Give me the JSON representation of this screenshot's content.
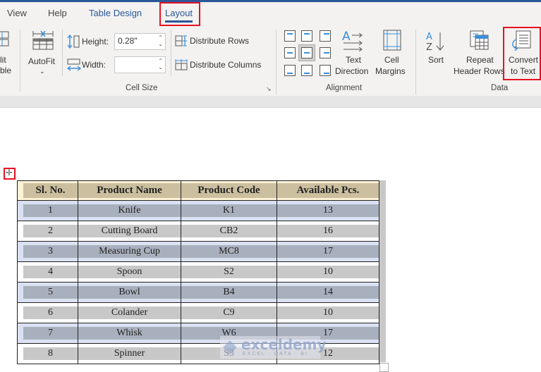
{
  "tabs": [
    {
      "label": "View",
      "active": false
    },
    {
      "label": "Help",
      "active": false
    },
    {
      "label": "Table Design",
      "active": false
    },
    {
      "label": "Layout",
      "active": true
    }
  ],
  "ribbon": {
    "split_table": {
      "line1": "lit",
      "line2": "ble"
    },
    "autofit": {
      "label": "AutoFit"
    },
    "height": {
      "label": "Height:",
      "value": "0.28\""
    },
    "width": {
      "label": "Width:",
      "value": ""
    },
    "distribute_rows": "Distribute Rows",
    "distribute_columns": "Distribute Columns",
    "cell_size_group": "Cell Size",
    "text_direction": {
      "line1": "Text",
      "line2": "Direction"
    },
    "cell_margins": {
      "line1": "Cell",
      "line2": "Margins"
    },
    "alignment_group": "Alignment",
    "sort": "Sort",
    "repeat_header": {
      "line1": "Repeat",
      "line2": "Header Rows"
    },
    "convert_to_text": {
      "line1": "Convert",
      "line2": "to Text"
    },
    "data_group": "Data"
  },
  "table": {
    "headers": [
      "Sl. No.",
      "Product Name",
      "Product Code",
      "Available Pcs."
    ],
    "rows": [
      [
        "1",
        "Knife",
        "K1",
        "13"
      ],
      [
        "2",
        "Cutting Board",
        "CB2",
        "16"
      ],
      [
        "3",
        "Measuring Cup",
        "MC8",
        "17"
      ],
      [
        "4",
        "Spoon",
        "S2",
        "10"
      ],
      [
        "5",
        "Bowl",
        "B4",
        "14"
      ],
      [
        "6",
        "Colander",
        "C9",
        "10"
      ],
      [
        "7",
        "Whisk",
        "W6",
        "17"
      ],
      [
        "8",
        "Spinner",
        "S3",
        "12"
      ]
    ]
  },
  "watermark": {
    "brand": "exceldemy",
    "tagline": "EXCEL · DATA · BI"
  },
  "colors": {
    "accent": "#2b579a",
    "highlight_box": "#e81123",
    "header_fill": "#cbbf9f",
    "band_blue": "#d9e1f2"
  }
}
